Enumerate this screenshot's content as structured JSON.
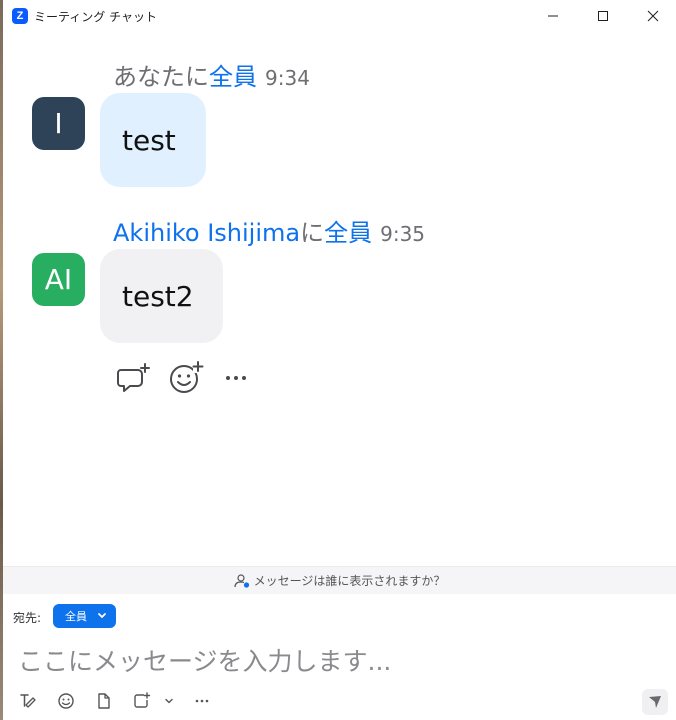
{
  "window": {
    "title": "ミーティング チャット",
    "app_icon_letter": "Z"
  },
  "messages": [
    {
      "sender": "あなた",
      "joiner": "に",
      "recipient": "全員",
      "time": "9:34",
      "avatar_text": "I",
      "avatar_color": "#2f4358",
      "text": "test",
      "bubble_color": "#e0f0ff"
    },
    {
      "sender": "Akihiko Ishijima",
      "joiner": "に",
      "recipient": "全員",
      "time": "9:35",
      "avatar_text": "AI",
      "avatar_color": "#27ae60",
      "text": "test2",
      "bubble_color": "#f1f1f4"
    }
  ],
  "reactions": [
    "reply-icon",
    "add-emoji-icon",
    "more-icon"
  ],
  "notice": {
    "text": "メッセージは誰に表示されますか？"
  },
  "composer": {
    "to_label": "宛先:",
    "to_value": "全員",
    "placeholder": "ここにメッセージを入力します..."
  },
  "colors": {
    "accent": "#0e72ed"
  }
}
